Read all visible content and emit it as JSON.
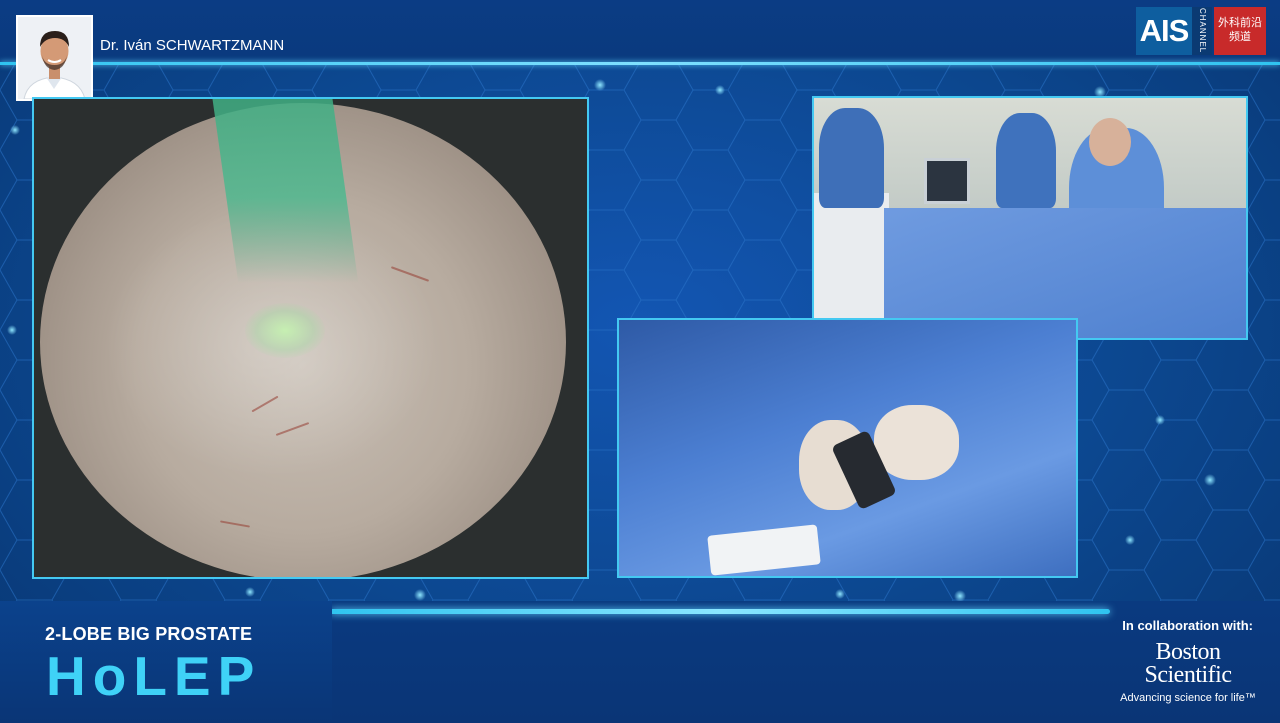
{
  "header": {
    "speaker_name": "Dr. Iván SCHWARTZMANN",
    "channel_logo": {
      "brand": "AIS",
      "channel_label": "CHANNEL",
      "chinese_line1": "外科前沿",
      "chinese_line2": "频道"
    }
  },
  "footer": {
    "subtitle": "2-LOBE BIG PROSTATE",
    "title": "HoLEP",
    "collaboration_label": "In collaboration with:",
    "sponsor": {
      "name_line1": "Boston",
      "name_line2": "Scientific",
      "tagline": "Advancing science for life™"
    }
  },
  "colors": {
    "background": "#0c478f",
    "accent_cyan": "#3fd2f7",
    "panel_border": "#44c9f2",
    "logo_red": "#c82a2a"
  },
  "icons": {
    "speaker_avatar": "person-portrait-icon"
  }
}
